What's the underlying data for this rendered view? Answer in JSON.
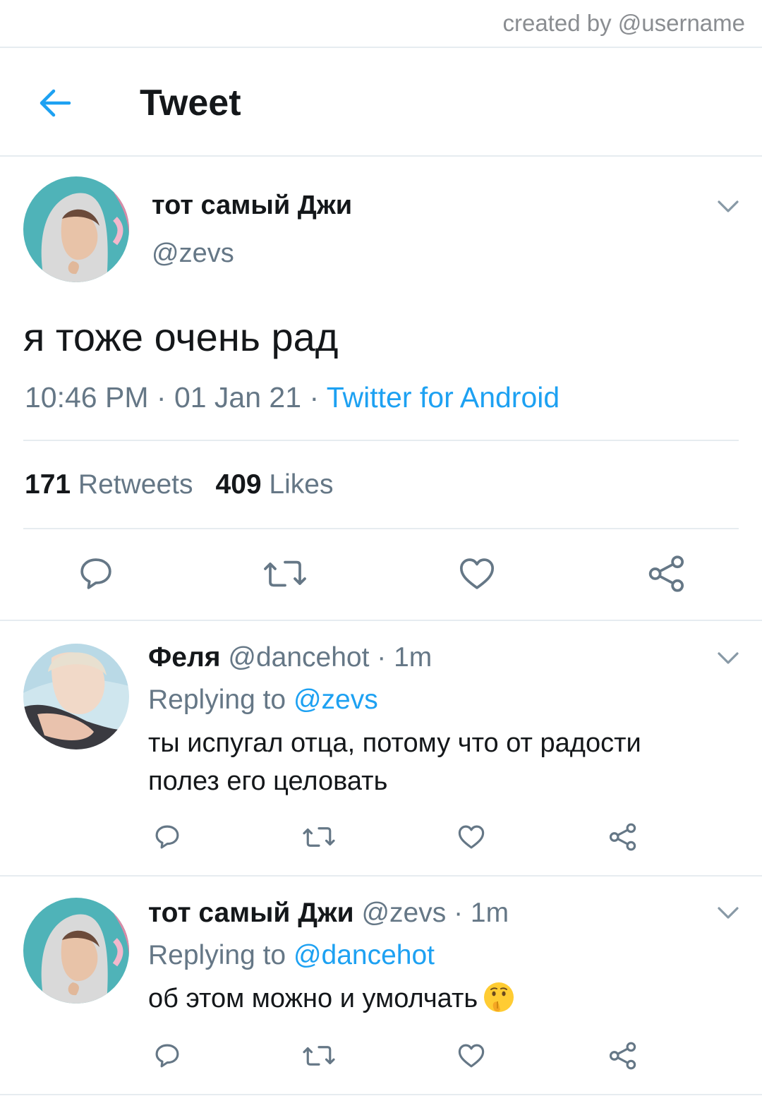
{
  "watermark": "created by @username",
  "header": {
    "title": "Tweet",
    "back_icon": "arrow-left-icon"
  },
  "tweet": {
    "display_name": "тот самый Джи",
    "handle": "@zevs",
    "text": "я тоже очень рад",
    "time": "10:46 PM",
    "sep1": " · ",
    "date": "01 Jan 21",
    "sep2": " · ",
    "source": "Twitter for Android",
    "retweets_count": "171",
    "retweets_label": "Retweets",
    "likes_count": "409",
    "likes_label": "Likes"
  },
  "replies": [
    {
      "display_name": "Феля",
      "handle": "@dancehot",
      "time": " · 1m",
      "replying_label": "Replying to ",
      "replying_to": "@zevs",
      "text": "ты испугал отца, потому что от радости полез его целовать"
    },
    {
      "display_name": "тот самый Джи",
      "handle": "@zevs",
      "time": " · 1m",
      "replying_label": "Replying to ",
      "replying_to": "@dancehot",
      "text": "об этом можно и умолчать",
      "emoji": "shushing-face-emoji"
    }
  ],
  "colors": {
    "accent": "#1da1f2",
    "secondary_text": "#657786",
    "icon": "#657786"
  }
}
